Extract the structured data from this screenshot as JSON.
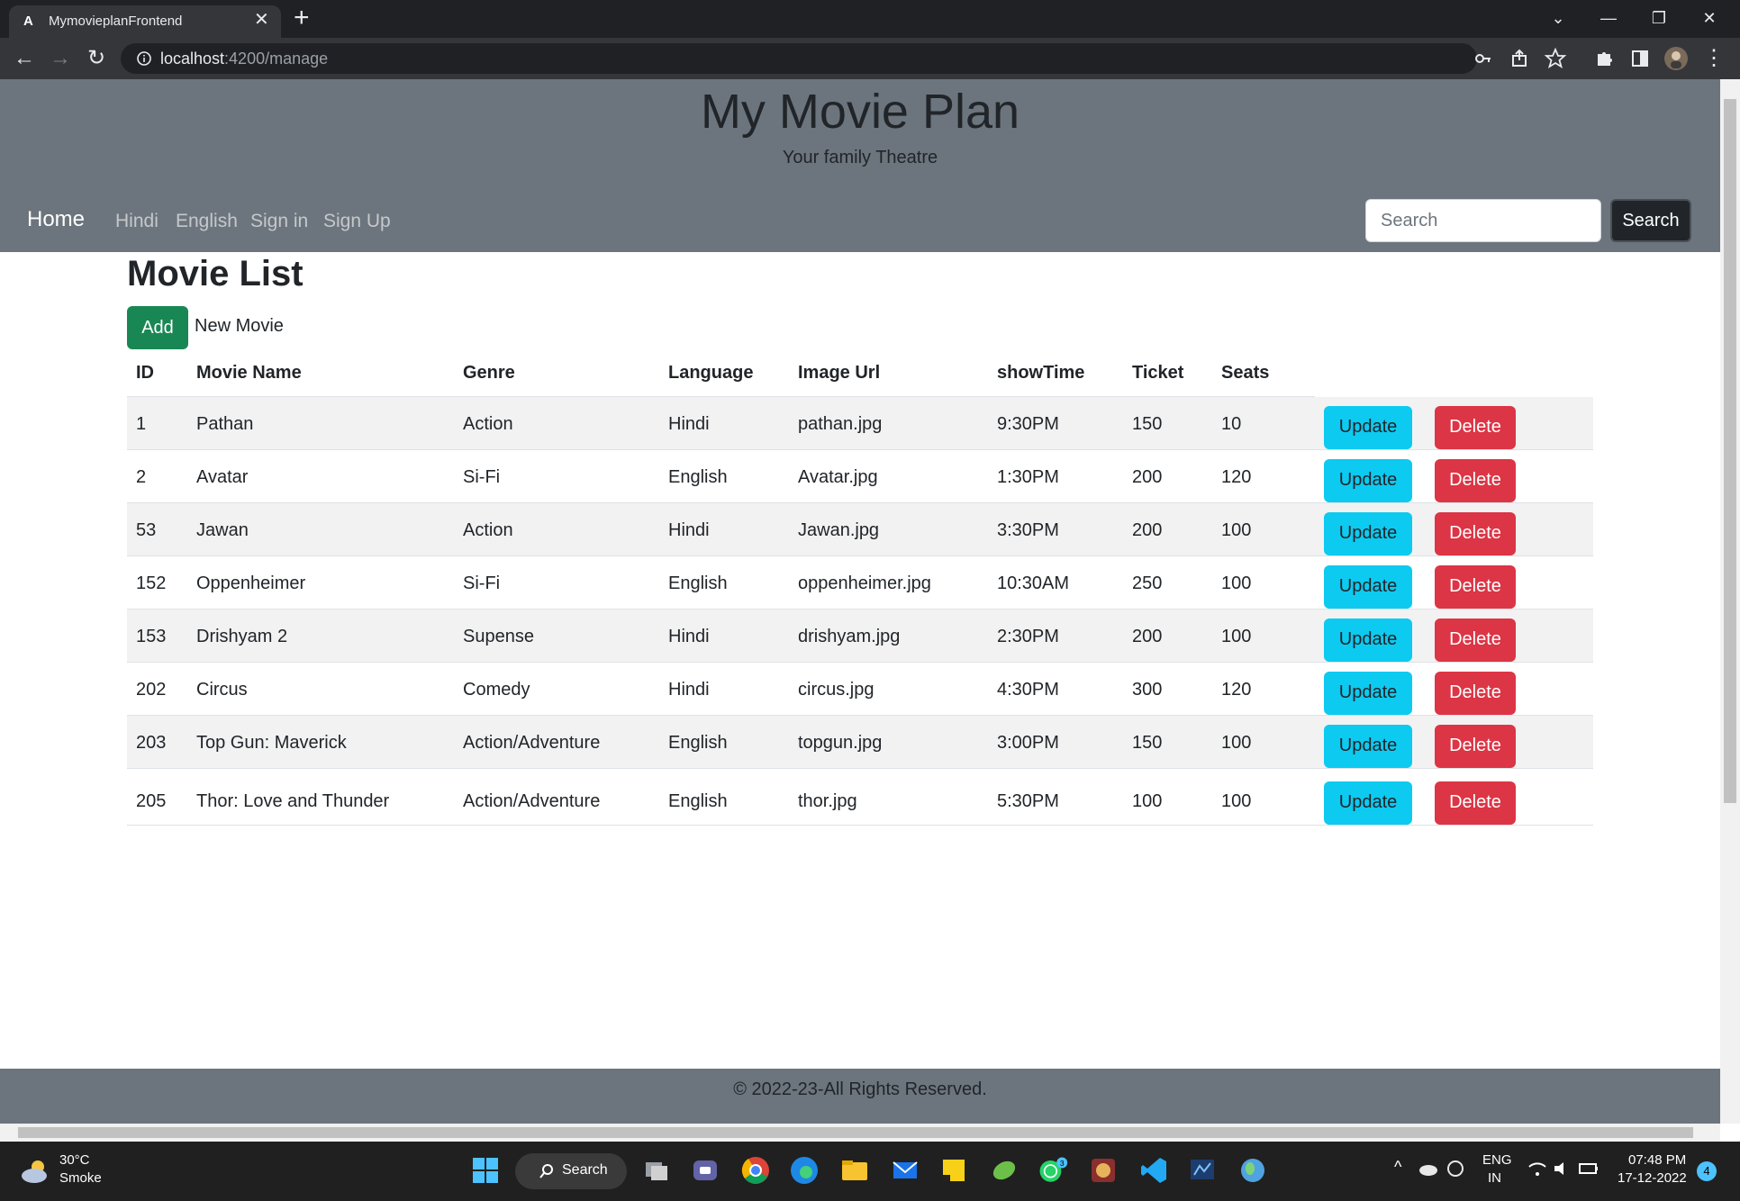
{
  "browser": {
    "tab_title": "MymovieplanFrontend",
    "url_host": "localhost",
    "url_path": ":4200/manage"
  },
  "site": {
    "title": "My Movie Plan",
    "subtitle": "Your family Theatre",
    "nav": {
      "home": "Home",
      "links": [
        "Hindi",
        "English",
        "Sign in",
        "Sign Up"
      ]
    },
    "search_placeholder": "Search",
    "search_button": "Search"
  },
  "main": {
    "heading": "Movie List",
    "add_button": "Add",
    "add_label": "New Movie",
    "columns": [
      "ID",
      "Movie Name",
      "Genre",
      "Language",
      "Image Url",
      "showTime",
      "Ticket",
      "Seats"
    ],
    "update_label": "Update",
    "delete_label": "Delete",
    "rows": [
      [
        "1",
        "Pathan",
        "Action",
        "Hindi",
        "pathan.jpg",
        "9:30PM",
        "150",
        "10"
      ],
      [
        "2",
        "Avatar",
        "Si-Fi",
        "English",
        "Avatar.jpg",
        "1:30PM",
        "200",
        "120"
      ],
      [
        "53",
        "Jawan",
        "Action",
        "Hindi",
        "Jawan.jpg",
        "3:30PM",
        "200",
        "100"
      ],
      [
        "152",
        "Oppenheimer",
        "Si-Fi",
        "English",
        "oppenheimer.jpg",
        "10:30AM",
        "250",
        "100"
      ],
      [
        "153",
        "Drishyam 2",
        "Supense",
        "Hindi",
        "drishyam.jpg",
        "2:30PM",
        "200",
        "100"
      ],
      [
        "202",
        "Circus",
        "Comedy",
        "Hindi",
        "circus.jpg",
        "4:30PM",
        "300",
        "120"
      ],
      [
        "203",
        "Top Gun: Maverick",
        "Action/Adventure",
        "English",
        "topgun.jpg",
        "3:00PM",
        "150",
        "100"
      ],
      [
        "205",
        "Thor: Love and Thunder",
        "Action/Adventure",
        "English",
        "thor.jpg",
        "5:30PM",
        "100",
        "100"
      ]
    ]
  },
  "footer": {
    "text": "© 2022-23-All Rights Reserved."
  },
  "taskbar": {
    "weather_temp": "30°C",
    "weather_desc": "Smoke",
    "search_label": "Search",
    "lang_line1": "ENG",
    "lang_line2": "IN",
    "time": "07:48 PM",
    "date": "17-12-2022",
    "notification_count": "4",
    "whatsapp_badge": "3"
  },
  "colors": {
    "header_bg": "#6c757d",
    "add_green": "#198754",
    "update_cyan": "#0dcaf0",
    "delete_red": "#dc3545"
  }
}
